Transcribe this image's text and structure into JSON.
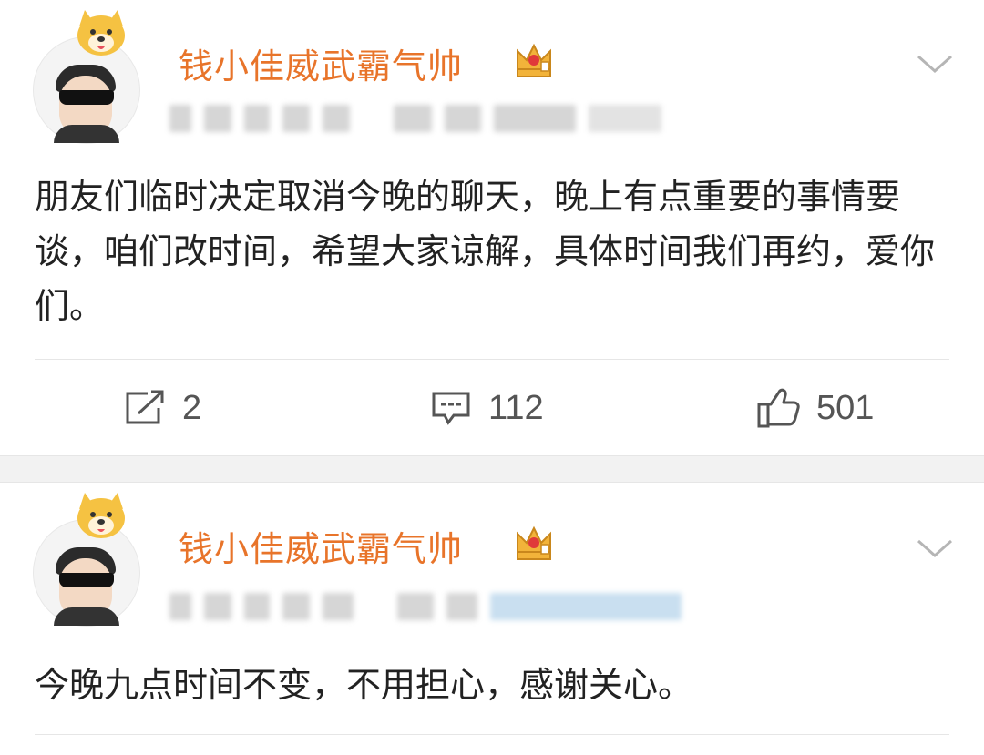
{
  "posts": [
    {
      "username": "钱小佳威武霸气帅",
      "content": "朋友们临时决定取消今晚的聊天，晚上有点重要的事情要谈，咱们改时间，希望大家谅解，具体时间我们再约，爱你们。",
      "actions": {
        "repost_count": "2",
        "comment_count": "112",
        "like_count": "501"
      },
      "icons": [
        "repost-icon",
        "comment-icon",
        "like-icon",
        "crown-icon",
        "chevron-down-icon"
      ]
    },
    {
      "username": "钱小佳威武霸气帅",
      "content": "今晚九点时间不变，不用担心，感谢关心。",
      "icons": [
        "crown-icon",
        "chevron-down-icon"
      ]
    }
  ],
  "colors": {
    "username": "#e8742a",
    "text": "#222222",
    "action_text": "#555555",
    "separator": "#f2f2f2"
  }
}
